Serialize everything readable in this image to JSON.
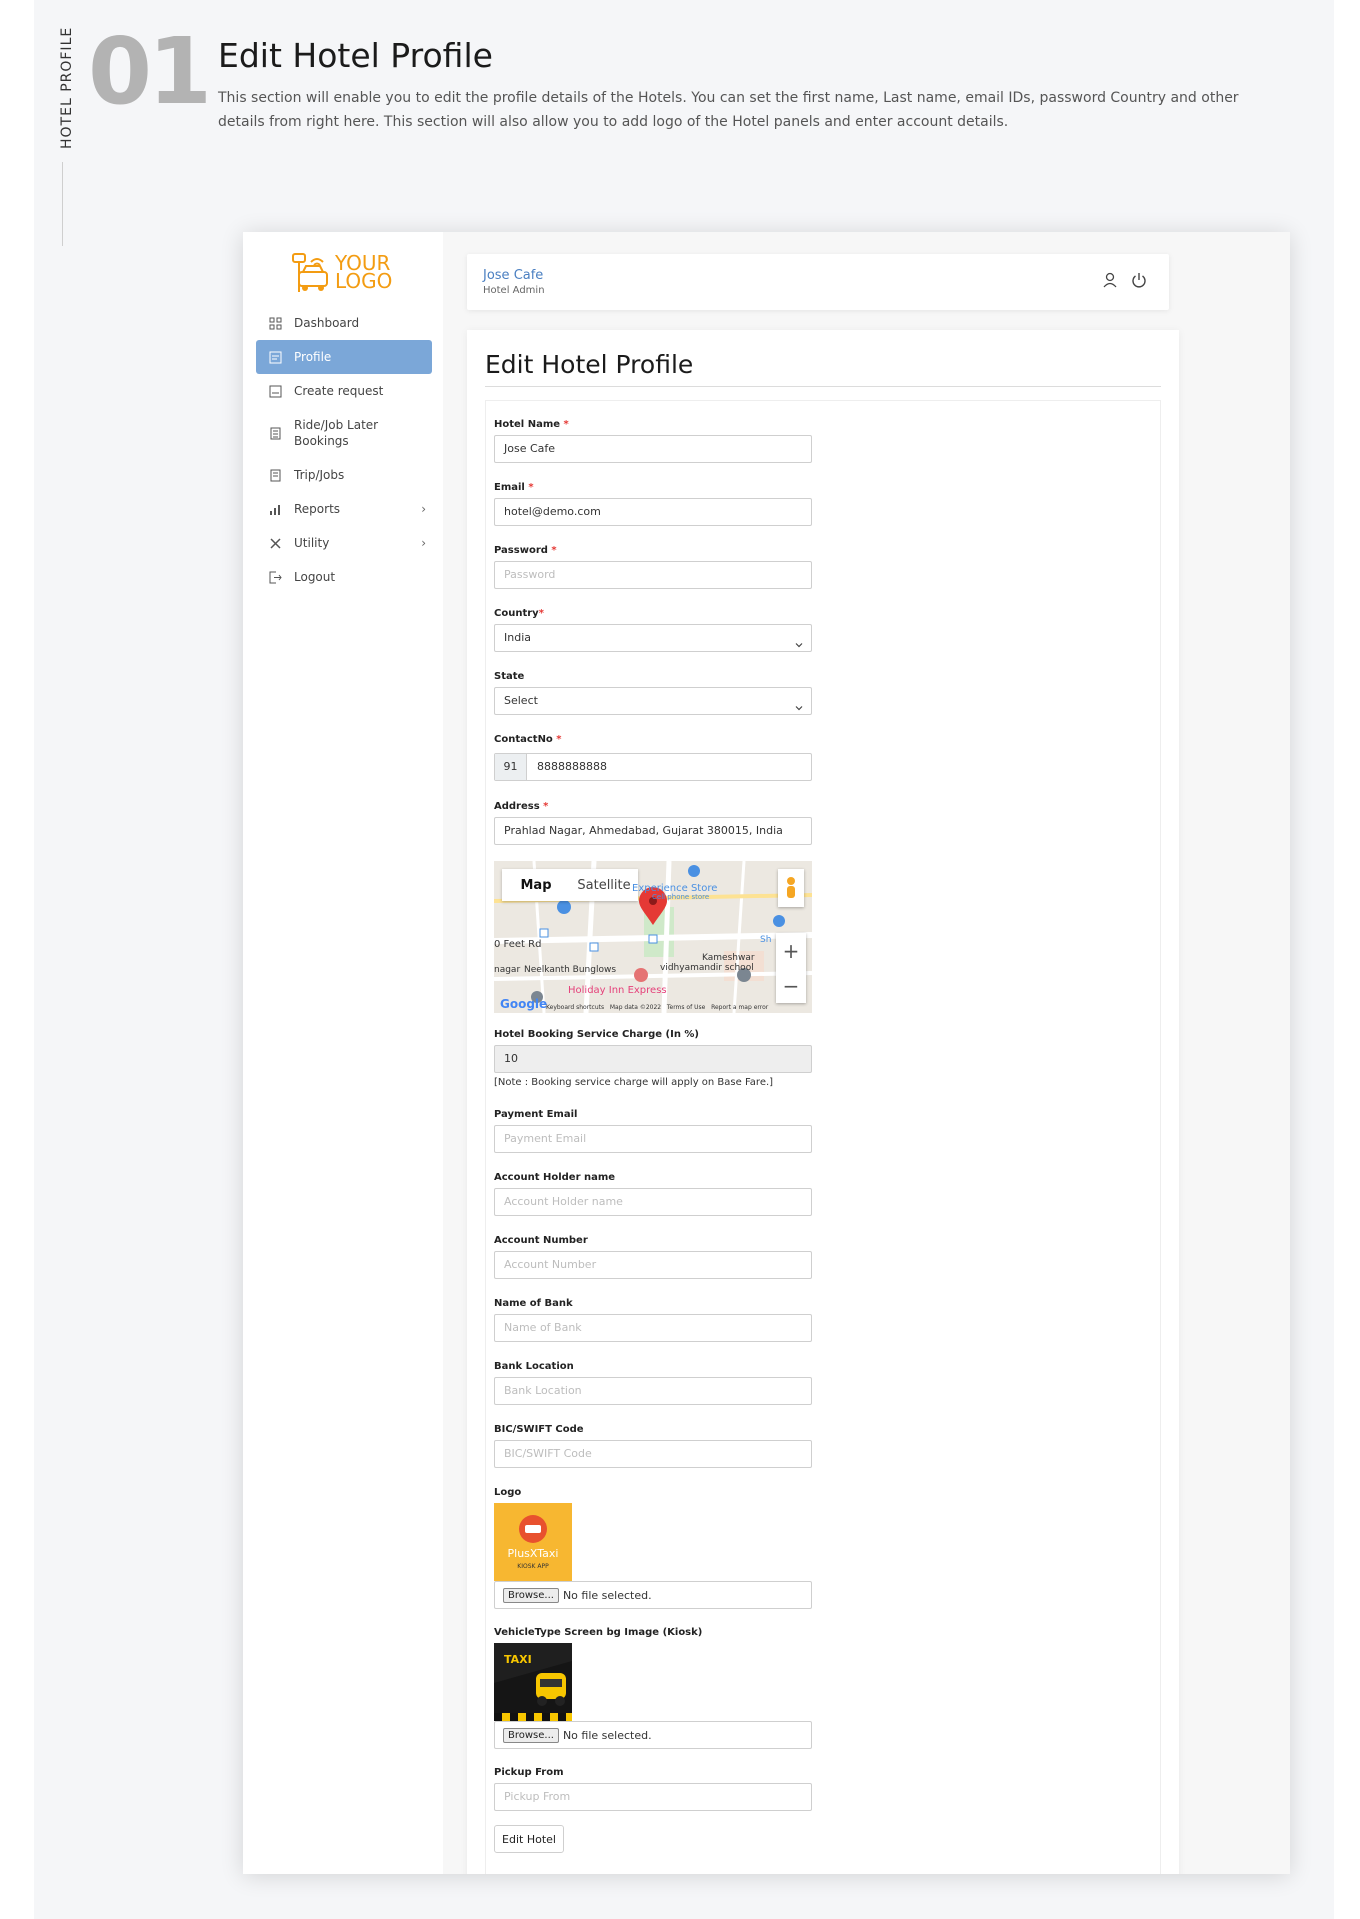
{
  "section": {
    "side_label": "HOTEL PROFILE",
    "number": "01",
    "title": "Edit Hotel Profile",
    "description": "This section will enable you to edit the profile details of the Hotels. You can set the first name, Last name, email IDs, password Country and other details from right here. This section will also allow you to add logo of the Hotel panels and enter account details."
  },
  "brand": {
    "logo_line1": "YOUR",
    "logo_line2": "LOGO",
    "accent": "#f39c12"
  },
  "sidebar": {
    "items": [
      {
        "label": "Dashboard",
        "icon": "dashboard-icon"
      },
      {
        "label": "Profile",
        "icon": "profile-icon",
        "active": true
      },
      {
        "label": "Create request",
        "icon": "create-request-icon"
      },
      {
        "label": "Ride/Job Later Bookings",
        "icon": "bookings-icon"
      },
      {
        "label": "Trip/Jobs",
        "icon": "trips-icon"
      },
      {
        "label": "Reports",
        "icon": "reports-icon",
        "submenu": true
      },
      {
        "label": "Utility",
        "icon": "utility-icon",
        "submenu": true
      },
      {
        "label": "Logout",
        "icon": "logout-icon"
      }
    ],
    "active_color": "#7ba7d8"
  },
  "topbar": {
    "user_name": "Jose Cafe",
    "user_role": "Hotel Admin",
    "icons": [
      "user-icon",
      "power-icon"
    ]
  },
  "page": {
    "title": "Edit Hotel Profile"
  },
  "form": {
    "hotel_name": {
      "label": "Hotel Name",
      "value": "Jose Cafe"
    },
    "email": {
      "label": "Email",
      "value": "hotel@demo.com"
    },
    "password": {
      "label": "Password",
      "placeholder": "Password"
    },
    "country": {
      "label": "Country",
      "value": "India"
    },
    "state": {
      "label": "State",
      "value": "Select"
    },
    "contact": {
      "label": "ContactNo",
      "prefix": "91",
      "value": "8888888888"
    },
    "address": {
      "label": "Address",
      "value": "Prahlad Nagar, Ahmedabad, Gujarat 380015, India"
    },
    "map": {
      "tab_map": "Map",
      "tab_satellite": "Satellite",
      "labels": [
        "Experience Store",
        "Cell phone store",
        "0 Feet Rd",
        "Neelkanth Bunglows",
        "Kameshwar",
        "vidhyamandir school",
        "Holiday Inn Express",
        "nagar",
        "Sh"
      ],
      "footer": [
        "Keyboard shortcuts",
        "Map data ©2022",
        "Terms of Use",
        "Report a map error"
      ],
      "google": "Google"
    },
    "service_charge": {
      "label": "Hotel Booking Service Charge (In %)",
      "value": "10",
      "note": "[Note : Booking service charge will apply on Base Fare.]"
    },
    "payment_email": {
      "label": "Payment Email",
      "placeholder": "Payment Email"
    },
    "account_holder": {
      "label": "Account Holder name",
      "placeholder": "Account Holder name"
    },
    "account_number": {
      "label": "Account Number",
      "placeholder": "Account Number"
    },
    "bank_name": {
      "label": "Name of Bank",
      "placeholder": "Name of Bank"
    },
    "bank_location": {
      "label": "Bank Location",
      "placeholder": "Bank Location"
    },
    "swift": {
      "label": "BIC/SWIFT Code",
      "placeholder": "BIC/SWIFT Code"
    },
    "logo": {
      "label": "Logo",
      "thumb_title": "PlusXTaxi",
      "thumb_sub": "KIOSK APP",
      "browse": "Browse...",
      "file_status": "No file selected."
    },
    "vehicle_bg": {
      "label": "VehicleType Screen bg Image (Kiosk)",
      "thumb_text": "TAXI",
      "browse": "Browse...",
      "file_status": "No file selected."
    },
    "pickup_from": {
      "label": "Pickup From",
      "placeholder": "Pickup From"
    },
    "submit": "Edit Hotel"
  }
}
